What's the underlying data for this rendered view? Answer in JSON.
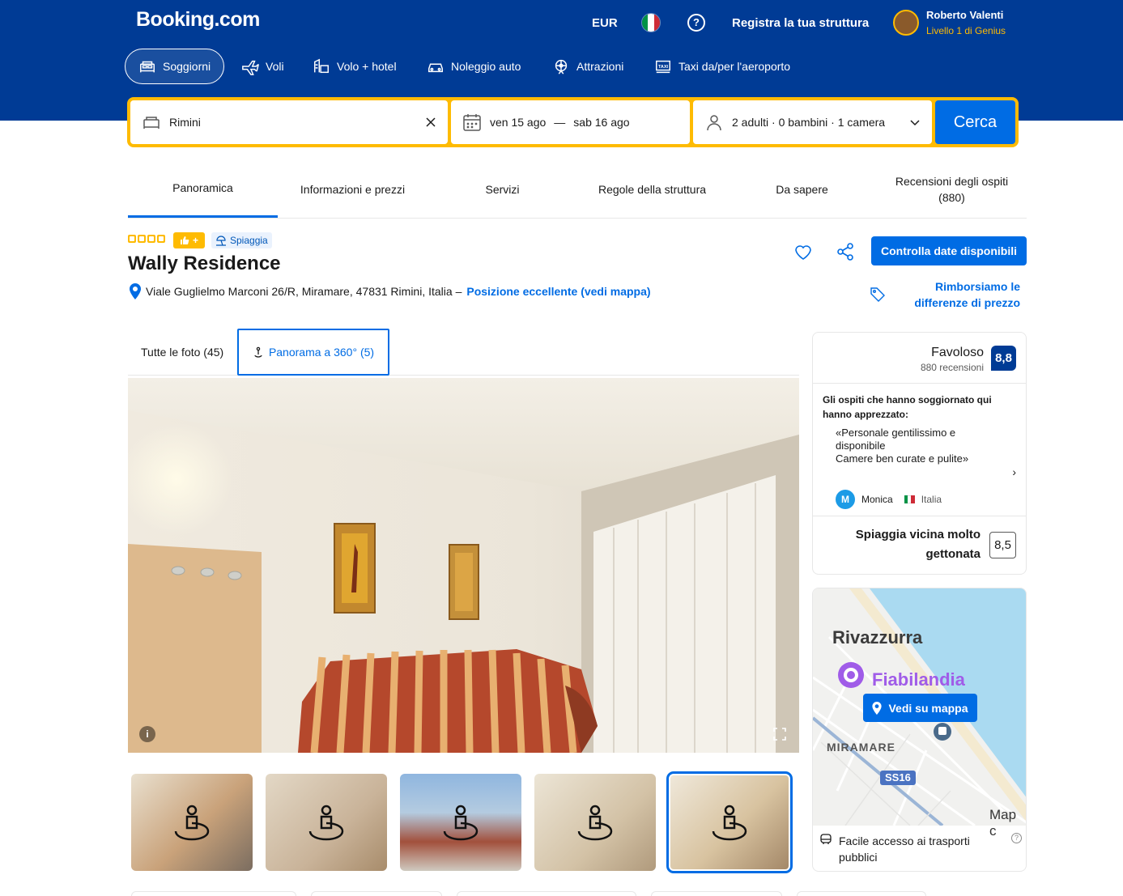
{
  "header": {
    "logo": "Booking.com",
    "currency": "EUR",
    "help": "?",
    "list_property": "Registra la tua struttura",
    "user_name": "Roberto Valenti",
    "user_level": "Livello 1 di Genius"
  },
  "nav": [
    {
      "label": "Soggiorni",
      "icon": "bed-icon",
      "active": true
    },
    {
      "label": "Voli",
      "icon": "plane-icon"
    },
    {
      "label": "Volo + hotel",
      "icon": "flight-hotel-icon"
    },
    {
      "label": "Noleggio auto",
      "icon": "car-icon"
    },
    {
      "label": "Attrazioni",
      "icon": "attractions-icon"
    },
    {
      "label": "Taxi da/per l'aeroporto",
      "icon": "taxi-icon"
    }
  ],
  "search": {
    "destination": "Rimini",
    "checkin": "ven 15 ago",
    "dash": "—",
    "checkout": "sab 16 ago",
    "guests": "2 adulti · 0 bambini · 1 camera",
    "button": "Cerca"
  },
  "tabs": [
    {
      "label": "Panoramica",
      "active": true
    },
    {
      "label": "Informazioni e prezzi"
    },
    {
      "label": "Servizi"
    },
    {
      "label": "Regole della struttura"
    },
    {
      "label": "Da sapere"
    },
    {
      "label": "Recensioni degli ospiti\n(880)"
    }
  ],
  "property": {
    "stars": 4,
    "badge_plus": "+",
    "beach_badge": "Spiaggia",
    "name": "Wally Residence",
    "address": "Viale Guglielmo Marconi 26/R, Miramare, 47831 Rimini, Italia –",
    "location_link": "Posizione eccellente (vedi mappa)",
    "check_dates": "Controlla date disponibili",
    "price_match": "Rimborsiamo le differenze di prezzo"
  },
  "photos": {
    "all_tab": "Tutte le foto (45)",
    "pano_tab": "Panorama a 360° (5)",
    "info_icon": "i",
    "thumbnails": [
      "360-panorama-1",
      "360-panorama-2",
      "360-panorama-3",
      "360-panorama-4",
      "360-panorama-5"
    ],
    "selected_thumbnail": 5
  },
  "review": {
    "label": "Favoloso",
    "count": "880 recensioni",
    "score": "8,8",
    "intro": "Gli ospiti che hanno soggiornato qui hanno apprezzato:",
    "quote": "«Personale gentilissimo e disponibile\nCamere ben curate e pulite»",
    "arrow": "›",
    "reviewer_initial": "M",
    "reviewer": "Monica",
    "reviewer_country": "Italia",
    "beach_label": "Spiaggia vicina molto gettonata",
    "beach_score": "8,5"
  },
  "map": {
    "place1": "Rivazzurra",
    "place2": "Fiabilandia",
    "place3": "MIRAMARE",
    "road": "SS16",
    "corner": "Map c",
    "button": "Vedi su mappa",
    "transport": "Facile accesso ai trasporti pubblici",
    "info": "?"
  },
  "colors": {
    "brand_blue": "#003b95",
    "accent_blue": "#006ce4",
    "yellow": "#febb02"
  }
}
